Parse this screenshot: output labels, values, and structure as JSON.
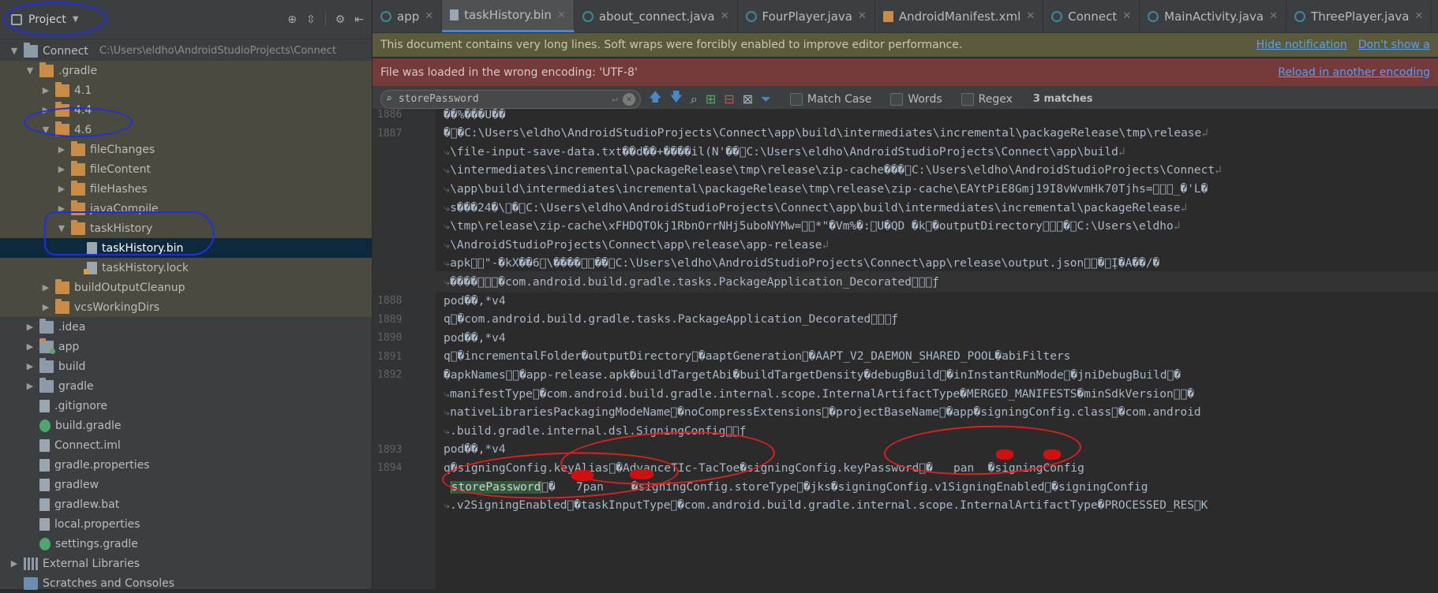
{
  "project_panel": {
    "title": "Project",
    "tree": [
      {
        "label": "Connect",
        "path": "C:\\Users\\eldho\\AndroidStudioProjects\\Connect",
        "depth": 0,
        "arrow": "down",
        "icon": "folder-grey"
      },
      {
        "label": ".gradle",
        "depth": 1,
        "arrow": "down",
        "icon": "folder"
      },
      {
        "label": "4.1",
        "depth": 2,
        "arrow": "right",
        "icon": "folder"
      },
      {
        "label": "4.4",
        "depth": 2,
        "arrow": "right",
        "icon": "folder"
      },
      {
        "label": "4.6",
        "depth": 2,
        "arrow": "down",
        "icon": "folder"
      },
      {
        "label": "fileChanges",
        "depth": 3,
        "arrow": "right",
        "icon": "folder"
      },
      {
        "label": "fileContent",
        "depth": 3,
        "arrow": "right",
        "icon": "folder"
      },
      {
        "label": "fileHashes",
        "depth": 3,
        "arrow": "right",
        "icon": "folder"
      },
      {
        "label": "javaCompile",
        "depth": 3,
        "arrow": "right",
        "icon": "folder"
      },
      {
        "label": "taskHistory",
        "depth": 3,
        "arrow": "down",
        "icon": "folder"
      },
      {
        "label": "taskHistory.bin",
        "depth": 4,
        "arrow": "",
        "icon": "file",
        "selected": true
      },
      {
        "label": "taskHistory.lock",
        "depth": 4,
        "arrow": "",
        "icon": "file-lock"
      },
      {
        "label": "buildOutputCleanup",
        "depth": 2,
        "arrow": "right",
        "icon": "folder"
      },
      {
        "label": "vcsWorkingDirs",
        "depth": 2,
        "arrow": "right",
        "icon": "folder"
      },
      {
        "label": ".idea",
        "depth": 1,
        "arrow": "right",
        "icon": "folder-grey"
      },
      {
        "label": "app",
        "depth": 1,
        "arrow": "right",
        "icon": "module"
      },
      {
        "label": "build",
        "depth": 1,
        "arrow": "right",
        "icon": "folder-grey"
      },
      {
        "label": "gradle",
        "depth": 1,
        "arrow": "right",
        "icon": "folder-grey"
      },
      {
        "label": ".gitignore",
        "depth": 1,
        "arrow": "",
        "icon": "file"
      },
      {
        "label": "build.gradle",
        "depth": 1,
        "arrow": "",
        "icon": "gradle"
      },
      {
        "label": "Connect.iml",
        "depth": 1,
        "arrow": "",
        "icon": "file"
      },
      {
        "label": "gradle.properties",
        "depth": 1,
        "arrow": "",
        "icon": "file"
      },
      {
        "label": "gradlew",
        "depth": 1,
        "arrow": "",
        "icon": "file"
      },
      {
        "label": "gradlew.bat",
        "depth": 1,
        "arrow": "",
        "icon": "file"
      },
      {
        "label": "local.properties",
        "depth": 1,
        "arrow": "",
        "icon": "file"
      },
      {
        "label": "settings.gradle",
        "depth": 1,
        "arrow": "",
        "icon": "gradle"
      },
      {
        "label": "External Libraries",
        "depth": 0,
        "arrow": "right",
        "icon": "libs"
      },
      {
        "label": "Scratches and Consoles",
        "depth": 0,
        "arrow": "",
        "icon": "scratch"
      }
    ]
  },
  "tabs": [
    {
      "label": "app",
      "icon": "module",
      "active": false
    },
    {
      "label": "taskHistory.bin",
      "icon": "file",
      "active": true
    },
    {
      "label": "about_connect.java",
      "icon": "class",
      "active": false
    },
    {
      "label": "FourPlayer.java",
      "icon": "class",
      "active": false
    },
    {
      "label": "AndroidManifest.xml",
      "icon": "xml",
      "active": false
    },
    {
      "label": "Connect",
      "icon": "module",
      "active": false
    },
    {
      "label": "MainActivity.java",
      "icon": "class",
      "active": false
    },
    {
      "label": "ThreePlayer.java",
      "icon": "class",
      "active": false
    }
  ],
  "notifications": {
    "long_lines": "This document contains very long lines. Soft wraps were forcibly enabled to improve editor performance.",
    "hide_link": "Hide notification",
    "dont_show_link": "Don't show a",
    "encoding": "File was loaded in the wrong encoding: 'UTF-8'",
    "reload_link": "Reload in another encoding"
  },
  "search": {
    "query": "storePassword",
    "match_case": "Match Case",
    "words": "Words",
    "regex": "Regex",
    "matches": "3 matches"
  },
  "code_lines": [
    {
      "ln": "1886",
      "text": "��%���U��",
      "cont": false
    },
    {
      "ln": "1887",
      "text": "�\u0000�C:\\Users\\eldho\\AndroidStudioProjects\\Connect\\app\\build\\intermediates\\incremental\\packageRelease\\tmp\\release",
      "cont": false,
      "wrap": true
    },
    {
      "ln": "",
      "text": "\\file-input-save-data.txt��d��+����il(N'��\u0000C:\\Users\\eldho\\AndroidStudioProjects\\Connect\\app\\build",
      "cont": true,
      "wrap": true
    },
    {
      "ln": "",
      "text": "\\intermediates\\incremental\\packageRelease\\tmp\\release\\zip-cache���\u0000C:\\Users\\eldho\\AndroidStudioProjects\\Connect",
      "cont": true,
      "wrap": true
    },
    {
      "ln": "",
      "text": "\\app\\build\\intermediates\\incremental\\packageRelease\\tmp\\release\\zip-cache\\EAYtPiE8Gmj19I8vWvmHk70Tjhs=\u0000\u0000\u0000_�'Ĺ�",
      "cont": true
    },
    {
      "ln": "",
      "text": "s���24�\\\u0000�\u0000C:\\Users\\eldho\\AndroidStudioProjects\\Connect\\app\\build\\intermediates\\incremental\\packageRelease",
      "cont": true,
      "wrap": true
    },
    {
      "ln": "",
      "text": "\\tmp\\release\\zip-cache\\xFHDQTOkj1RbnOrrNHj5uboNYMw=\u0000\u0000*\"�Vm%�:\u0000U�QD �k\u0000�outputDirectory\u0000\u0000\u0000�\u0000C:\\Users\\eldho",
      "cont": true,
      "wrap": true
    },
    {
      "ln": "",
      "text": "\\AndroidStudioProjects\\Connect\\app\\release\\app-release",
      "cont": true,
      "wrap": true
    },
    {
      "ln": "",
      "text": "apk\u0000\u0000\"-�kX��6\u0000\\����\u0000\u0000��\u0000C:\\Users\\eldho\\AndroidStudioProjects\\Connect\\app\\release\\output.json\u0000\u0000�\u0000Į�A��/�",
      "cont": true
    },
    {
      "ln": "",
      "text": "����\u0000\u0000\u0000�com.android.build.gradle.tasks.PackageApplication_Decorated\u0000\u0000\u0000ƒ",
      "cont": true,
      "caret": true
    },
    {
      "ln": "1888",
      "text": "pod��,*v4",
      "cont": false
    },
    {
      "ln": "1889",
      "text": "q\u0000�com.android.build.gradle.tasks.PackageApplication_Decorated\u0000\u0000\u0000ƒ",
      "cont": false
    },
    {
      "ln": "1890",
      "text": "pod��,*v4",
      "cont": false
    },
    {
      "ln": "1891",
      "text": "q\u0000�incrementalFolder�outputDirectory\u0000�aaptGeneration\u0000�AAPT_V2_DAEMON_SHARED_POOL�abiFilters",
      "cont": false
    },
    {
      "ln": "1892",
      "text": "�apkNames\u0000\u0000�app-release.apk�buildTargetAbi�buildTargetDensity�debugBuild\u0000�inInstantRunMode\u0000�jniDebugBuild\u0000�",
      "cont": false
    },
    {
      "ln": "",
      "text": "manifestType\u0000�com.android.build.gradle.internal.scope.InternalArtifactType�MERGED_MANIFESTS�minSdkVersion\u0000\u0000�",
      "cont": true
    },
    {
      "ln": "",
      "text": "nativeLibrariesPackagingModeName\u0000�noCompressExtensions\u0000�projectBaseName\u0000�app�signingConfig.class\u0000�com.android",
      "cont": true
    },
    {
      "ln": "",
      "text": ".build.gradle.internal.dsl.SigningConfig\u0000\u0000ƒ",
      "cont": true
    },
    {
      "ln": "1893",
      "text": "pod��,*v4",
      "cont": false
    },
    {
      "ln": "1894",
      "text": "q�signingConfig.keyAlias\u0000�AdvanceTIc-TacToe�signingConfig.keyPassword\u0000�   pan  �signingConfig",
      "cont": false
    },
    {
      "ln": "",
      "text_before": "",
      "highlight": "storePassword",
      "text_after": "\u0000�   7pan    �signingConfig.storeType\u0000�jks�signingConfig.v1SigningEnabled\u0000�signingConfig",
      "cont": true
    },
    {
      "ln": "",
      "text": ".v2SigningEnabled\u0000�taskInputType\u0000�com.android.build.gradle.internal.scope.InternalArtifactType�PROCESSED_RES\u0000K",
      "cont": true
    }
  ]
}
